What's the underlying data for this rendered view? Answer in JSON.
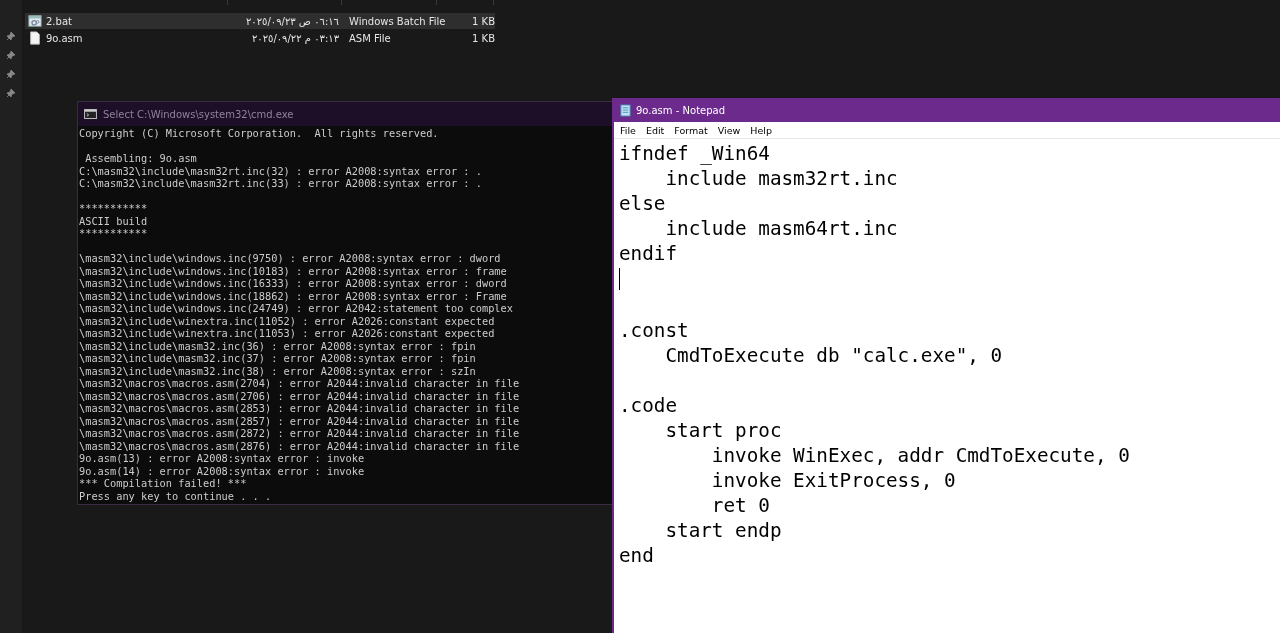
{
  "explorer": {
    "files": [
      {
        "kind": "batch",
        "name": "2.bat",
        "date": "٢٠٢٥/٠٩/٢٣ ص ٠٦:١٦",
        "type": "Windows Batch File",
        "size": "1 KB",
        "selected": true
      },
      {
        "kind": "text",
        "name": "9o.asm",
        "date": "٢٠٢٥/٠٩/٢٢ م ٠٣:١٣",
        "type": "ASM File",
        "size": "1 KB",
        "selected": false
      }
    ]
  },
  "console": {
    "title": "Select C:\\Windows\\system32\\cmd.exe",
    "output": "Copyright (C) Microsoft Corporation.  All rights reserved.\n\n Assembling: 9o.asm\nC:\\masm32\\include\\masm32rt.inc(32) : error A2008:syntax error : .\nC:\\masm32\\include\\masm32rt.inc(33) : error A2008:syntax error : .\n\n***********\nASCII build\n***********\n\n\\masm32\\include\\windows.inc(9750) : error A2008:syntax error : dword\n\\masm32\\include\\windows.inc(10183) : error A2008:syntax error : frame\n\\masm32\\include\\windows.inc(16333) : error A2008:syntax error : dword\n\\masm32\\include\\windows.inc(18862) : error A2008:syntax error : Frame\n\\masm32\\include\\windows.inc(24749) : error A2042:statement too complex\n\\masm32\\include\\winextra.inc(11052) : error A2026:constant expected\n\\masm32\\include\\winextra.inc(11053) : error A2026:constant expected\n\\masm32\\include\\masm32.inc(36) : error A2008:syntax error : fpin\n\\masm32\\include\\masm32.inc(37) : error A2008:syntax error : fpin\n\\masm32\\include\\masm32.inc(38) : error A2008:syntax error : szIn\n\\masm32\\macros\\macros.asm(2704) : error A2044:invalid character in file\n\\masm32\\macros\\macros.asm(2706) : error A2044:invalid character in file\n\\masm32\\macros\\macros.asm(2853) : error A2044:invalid character in file\n\\masm32\\macros\\macros.asm(2857) : error A2044:invalid character in file\n\\masm32\\macros\\macros.asm(2872) : error A2044:invalid character in file\n\\masm32\\macros\\macros.asm(2876) : error A2044:invalid character in file\n9o.asm(13) : error A2008:syntax error : invoke\n9o.asm(14) : error A2008:syntax error : invoke\n*** Compilation failed! ***\nPress any key to continue . . ."
  },
  "notepad": {
    "title": "9o.asm - Notepad",
    "menu": [
      "File",
      "Edit",
      "Format",
      "View",
      "Help"
    ],
    "content": "ifndef _Win64\n    include masm32rt.inc\nelse\n    include masm64rt.inc\nendif\n\n\n.const\n    CmdToExecute db \"calc.exe\", 0\n\n.code\n    start proc\n        invoke WinExec, addr CmdToExecute, 0\n        invoke ExitProcess, 0\n        ret 0\n    start endp\nend"
  }
}
